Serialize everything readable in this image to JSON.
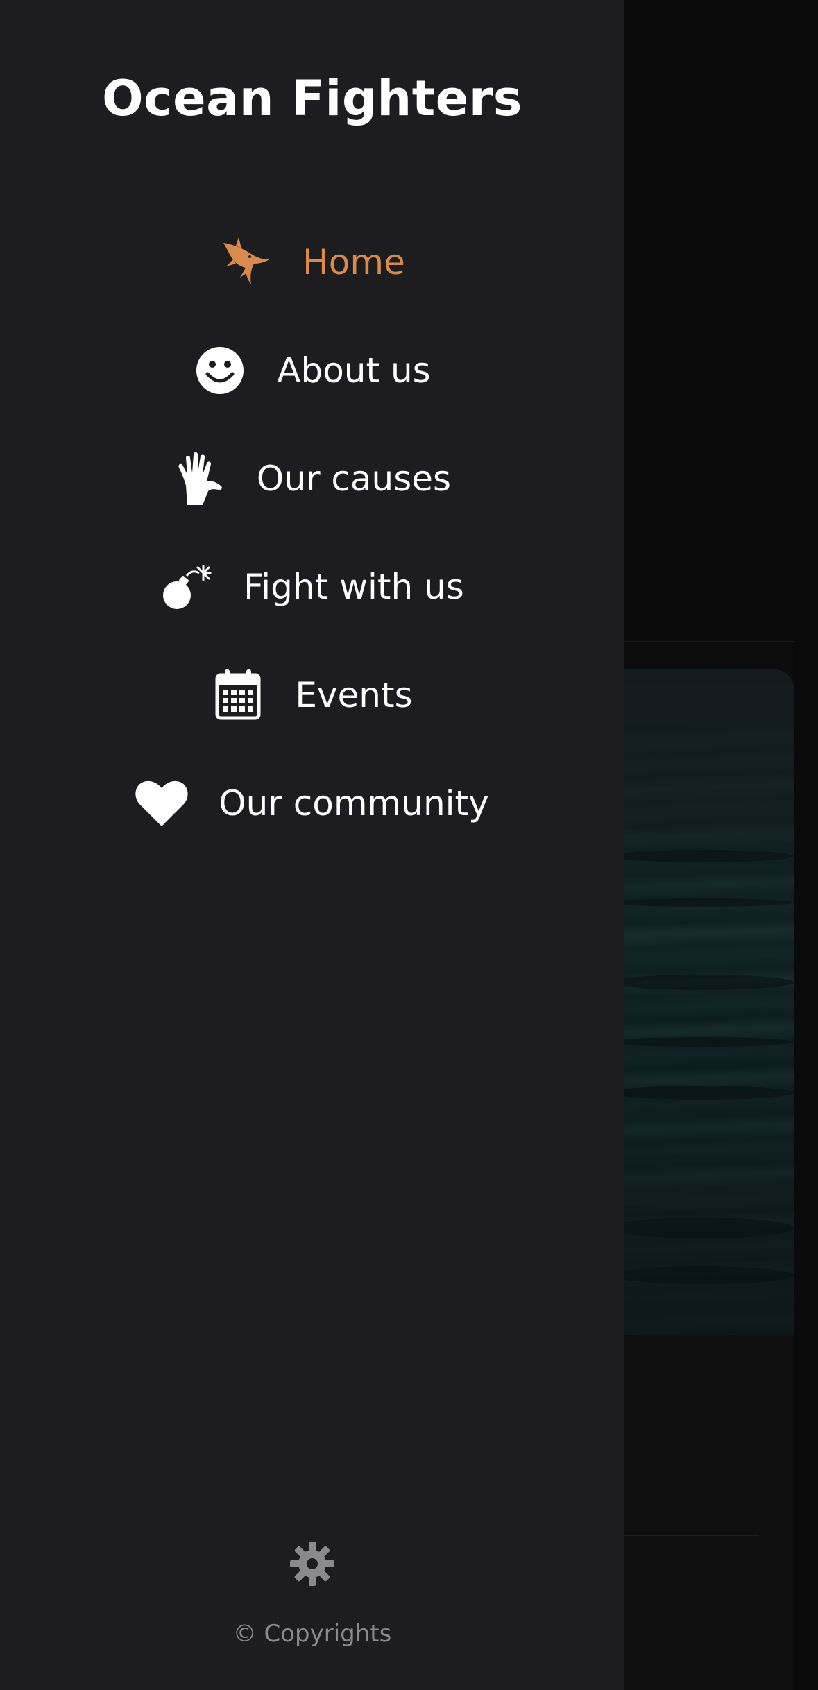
{
  "drawer": {
    "title": "Ocean Fighters",
    "active_color": "#d98a4e",
    "items": [
      {
        "label": "Home",
        "icon": "shark-icon",
        "active": true
      },
      {
        "label": "About us",
        "icon": "smile-icon",
        "active": false
      },
      {
        "label": "Our causes",
        "icon": "hand-icon",
        "active": false
      },
      {
        "label": "Fight with us",
        "icon": "bomb-icon",
        "active": false
      },
      {
        "label": "Events",
        "icon": "calendar-icon",
        "active": false
      },
      {
        "label": "Our community",
        "icon": "heart-icon",
        "active": false
      }
    ],
    "settings_icon": "gear-icon",
    "copyright": "© Copyrights"
  }
}
